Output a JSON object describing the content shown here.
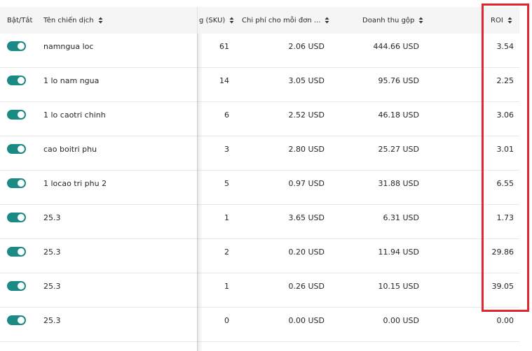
{
  "table": {
    "columns": {
      "toggle": "Bật/Tắt",
      "name": "Tên chiến dịch",
      "sku": "g (SKU)",
      "cpo": "Chi phí cho mỗi đơn ...",
      "revenue": "Doanh thu gộp",
      "roi": "ROI"
    },
    "rows": [
      {
        "enabled": true,
        "name": "namngua loc",
        "sku": "61",
        "cpo": "2.06 USD",
        "revenue": "444.66 USD",
        "roi": "3.54"
      },
      {
        "enabled": true,
        "name": "1 lo nam ngua",
        "sku": "14",
        "cpo": "3.05 USD",
        "revenue": "95.76 USD",
        "roi": "2.25"
      },
      {
        "enabled": true,
        "name": "1 lo caotri chinh",
        "sku": "6",
        "cpo": "2.52 USD",
        "revenue": "46.18 USD",
        "roi": "3.06"
      },
      {
        "enabled": true,
        "name": "cao boitri phu",
        "sku": "3",
        "cpo": "2.80 USD",
        "revenue": "25.27 USD",
        "roi": "3.01"
      },
      {
        "enabled": true,
        "name": "1 locao tri phu 2",
        "sku": "5",
        "cpo": "0.97 USD",
        "revenue": "31.88 USD",
        "roi": "6.55"
      },
      {
        "enabled": true,
        "name": "25.3",
        "sku": "1",
        "cpo": "3.65 USD",
        "revenue": "6.31 USD",
        "roi": "1.73"
      },
      {
        "enabled": true,
        "name": "25.3",
        "sku": "2",
        "cpo": "0.20 USD",
        "revenue": "11.94 USD",
        "roi": "29.86"
      },
      {
        "enabled": true,
        "name": "25.3",
        "sku": "1",
        "cpo": "0.26 USD",
        "revenue": "10.15 USD",
        "roi": "39.05"
      },
      {
        "enabled": true,
        "name": "25.3",
        "sku": "0",
        "cpo": "0.00 USD",
        "revenue": "0.00 USD",
        "roi": "0.00"
      }
    ]
  },
  "colors": {
    "toggle_on": "#1a8a84",
    "highlight": "#e0262f",
    "header_bg": "#f5f5f6"
  },
  "icons": {
    "sort": "sort-icon",
    "toggle": "toggle-switch"
  }
}
